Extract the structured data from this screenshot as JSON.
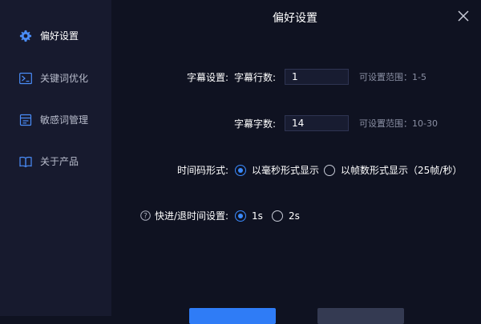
{
  "sidebar": {
    "items": [
      {
        "label": "偏好设置",
        "icon": "gear-icon",
        "active": true
      },
      {
        "label": "关键词优化",
        "icon": "keyword-optimize-icon",
        "active": false
      },
      {
        "label": "敏感词管理",
        "icon": "sensitive-words-icon",
        "active": false
      },
      {
        "label": "关于产品",
        "icon": "book-icon",
        "active": false
      }
    ]
  },
  "header": {
    "title": "偏好设置"
  },
  "subtitle": {
    "label": "字幕设置:",
    "lines_label": "字幕行数:",
    "lines_value": "1",
    "lines_hint": "可设置范围：1-5",
    "chars_label": "字幕字数:",
    "chars_value": "14",
    "chars_hint": "可设置范围：10-30"
  },
  "timecode": {
    "label": "时间码形式:",
    "options": [
      {
        "label": "以毫秒形式显示",
        "selected": true
      },
      {
        "label": "以帧数形式显示（25帧/秒）",
        "selected": false
      }
    ]
  },
  "seek": {
    "label": "快进/退时间设置:",
    "options": [
      {
        "label": "1s",
        "selected": true
      },
      {
        "label": "2s",
        "selected": false
      }
    ]
  },
  "colors": {
    "accent": "#3b8bff",
    "background": "#0f1221",
    "sidebar": "#171a2e"
  }
}
